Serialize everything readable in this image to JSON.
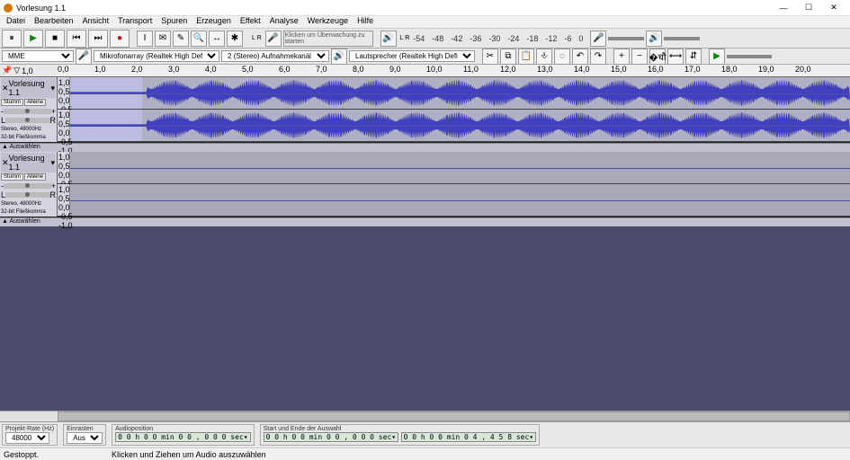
{
  "window": {
    "title": "Vorlesung 1.1",
    "min": "—",
    "max": "☐",
    "close": "✕"
  },
  "menu": [
    "Datei",
    "Bearbeiten",
    "Ansicht",
    "Transport",
    "Spuren",
    "Erzeugen",
    "Effekt",
    "Analyse",
    "Werkzeuge",
    "Hilfe"
  ],
  "transport": {
    "pause": "⏸",
    "play": "▶",
    "stop": "■",
    "skip_start": "⏮",
    "skip_end": "⏭",
    "record": "●"
  },
  "tools": {
    "select": "I",
    "env": "✉",
    "draw": "✎",
    "zoom": "🔍",
    "time": "↔",
    "multi": "✱"
  },
  "edit": {
    "cut": "✂",
    "copy": "⧉",
    "paste": "📋",
    "trim": "⎀",
    "silence": "◌",
    "undo": "↶",
    "redo": "↷",
    "zoomin": "+",
    "zoomout": "−",
    "fitsel": "�चौ",
    "fitproj": "⟷",
    "ztoggle": "⇵"
  },
  "meters": {
    "rec_hint": "Klicken um Überwachung zu starten",
    "lr": "L\nR",
    "mic": "🎤",
    "spk": "🔊"
  },
  "dbscale": [
    "-54",
    "-48",
    "-42",
    "-36",
    "-30",
    "-24",
    "-18",
    "-12",
    "-6",
    "0"
  ],
  "devices": {
    "host_label": "MME",
    "input": "Mikrofonarray (Realtek High Def",
    "channels": "2 (Stereo) Aufnahmekanäl",
    "output": "Lautsprecher (Realtek High Defi"
  },
  "ruler": {
    "pin": "📌",
    "cursor": "▽",
    "start": "1,0",
    "ticks": [
      "0,0",
      "1,0",
      "2,0",
      "3,0",
      "4,0",
      "5,0",
      "6,0",
      "7,0",
      "8,0",
      "9,0",
      "10,0",
      "11,0",
      "12,0",
      "13,0",
      "14,0",
      "15,0",
      "16,0",
      "17,0",
      "18,0",
      "19,0",
      "20,0"
    ]
  },
  "track1": {
    "name": "Vorlesung 1.1",
    "close": "✕",
    "menu": "▾",
    "mute": "Stumm",
    "solo": "Alleine",
    "gain_l": "-",
    "gain_r": "+",
    "pan_l": "L",
    "pan_r": "R",
    "info1": "Stereo, 48000Hz",
    "info2": "32-bit Fließkomma",
    "foot": "▲ Auswählen",
    "scale": [
      "1,0",
      "0,5",
      "0,0",
      "-0,5",
      "-1,0"
    ]
  },
  "track2": {
    "name": "Vorlesung 1.1",
    "close": "✕",
    "menu": "▾",
    "mute": "Stumm",
    "solo": "Alleine",
    "gain_l": "-",
    "gain_r": "+",
    "pan_l": "L",
    "pan_r": "R",
    "info1": "Stereo, 48000Hz",
    "info2": "32-bit Fließkomma",
    "foot": "▲ Auswählen",
    "scale": [
      "1,0",
      "0,5",
      "0,0",
      "-0,5",
      "-1,0"
    ]
  },
  "bottom": {
    "rate_label": "Projekt-Rate (Hz)",
    "rate": "48000",
    "snap_label": "Einrasten",
    "snap": "Aus",
    "pos_label": "Audioposition",
    "pos": "0 0 h 0 0 min 0 0 , 0 0 0 sec▾",
    "sel_label": "Start und Ende der Auswahl",
    "sel_start": "0 0 h 0 0 min 0 0 , 0 0 0 sec▾",
    "sel_end": "0 0 h 0 0 min 0 4 , 4 5 8 sec▾"
  },
  "status": {
    "state": "Gestoppt.",
    "hint": "Klicken und Ziehen um Audio auszuwählen"
  }
}
